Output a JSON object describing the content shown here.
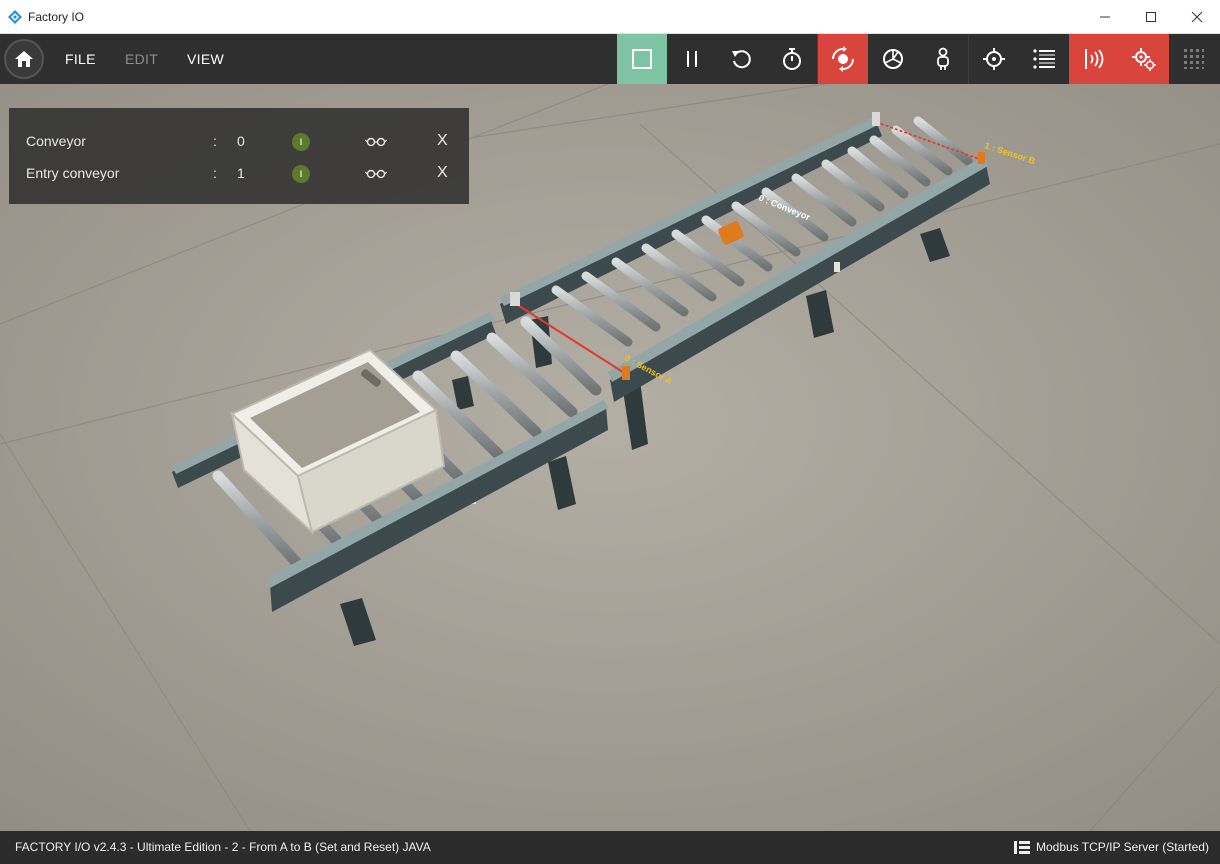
{
  "window": {
    "title": "Factory IO",
    "icons": {
      "app": "factory-io-diamond-icon",
      "minimize": "minimize-icon",
      "maximize": "maximize-icon",
      "close": "close-icon"
    }
  },
  "toolbar": {
    "menu": {
      "file": "FILE",
      "edit": "EDIT",
      "view": "VIEW"
    },
    "buttons": [
      {
        "id": "stop",
        "icon": "stop-square-icon",
        "state": "active-green"
      },
      {
        "id": "pause",
        "icon": "pause-icon"
      },
      {
        "id": "reset",
        "icon": "reset-icon"
      },
      {
        "id": "timer",
        "icon": "stopwatch-icon"
      },
      {
        "id": "camera-orbit",
        "icon": "orbit-camera-icon",
        "state": "active-red"
      },
      {
        "id": "camera-fly",
        "icon": "fly-camera-icon"
      },
      {
        "id": "camera-person",
        "icon": "first-person-icon"
      },
      {
        "id": "target",
        "icon": "crosshair-icon"
      },
      {
        "id": "tags",
        "icon": "list-icon"
      },
      {
        "id": "sensors",
        "icon": "sensor-icon",
        "state": "active-red"
      },
      {
        "id": "drivers",
        "icon": "gears-icon",
        "state": "active-red"
      },
      {
        "id": "grid",
        "icon": "grid-icon",
        "state": "dimmed"
      }
    ],
    "colors": {
      "bar": "#2f2f2f",
      "green": "#7ec4a4",
      "red": "#d9453d"
    }
  },
  "tag_panel": {
    "rows": [
      {
        "name": "Conveyor",
        "colon": ":",
        "address": "0",
        "led": "I",
        "watch_icon": "glasses-icon",
        "remove": "X"
      },
      {
        "name": "Entry conveyor",
        "colon": ":",
        "address": "1",
        "led": "I",
        "watch_icon": "glasses-icon",
        "remove": "X"
      }
    ]
  },
  "scene": {
    "labels": {
      "conveyor": "0 : Conveyor",
      "sensor_a": "0 : Sensor A",
      "sensor_b": "1 : Sensor B"
    },
    "colors": {
      "floor": "#a8a49a",
      "frame": "#3d4a4d",
      "rail": "#93a6a8",
      "roller": "#b7babb",
      "box": "#e8e6df",
      "motor": "#e07a1f",
      "label": "#f2c318",
      "beam": "#e03a2f"
    }
  },
  "status_bar": {
    "left": "FACTORY I/O v2.4.3 - Ultimate Edition - 2 - From A to B (Set and Reset) JAVA",
    "right": "Modbus TCP/IP Server (Started)",
    "icon": "server-icon"
  }
}
